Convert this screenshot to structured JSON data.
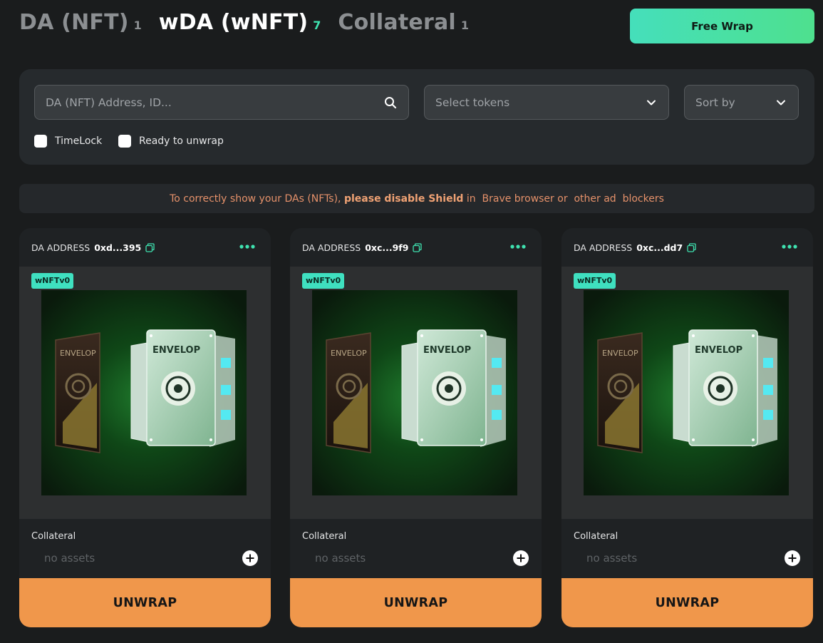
{
  "tabs": [
    {
      "label": "DA (NFT)",
      "count": "1",
      "active": false
    },
    {
      "label": "wDA (wNFT)",
      "count": "7",
      "active": true
    },
    {
      "label": "Collateral",
      "count": "1",
      "active": false
    }
  ],
  "free_wrap_label": "Free Wrap",
  "filters": {
    "search_placeholder": "DA (NFT) Address, ID...",
    "tokens_placeholder": "Select tokens",
    "sort_placeholder": "Sort by",
    "timelock_label": "TimeLock",
    "ready_label": "Ready to unwrap"
  },
  "notice": {
    "before": "To correctly show your DAs (NFTs), ",
    "bold": "please disable Shield",
    "after": " in  Brave browser or  other ad  blockers"
  },
  "cards": [
    {
      "address_label": "DA ADDRESS",
      "address": "0xd...395",
      "badge": "wNFTv0",
      "image_brand": "ENVELOP",
      "collateral_label": "Collateral",
      "collateral_value": "no assets",
      "unwrap_label": "UNWRAP"
    },
    {
      "address_label": "DA ADDRESS",
      "address": "0xc...9f9",
      "badge": "wNFTv0",
      "image_brand": "ENVELOP",
      "collateral_label": "Collateral",
      "collateral_value": "no assets",
      "unwrap_label": "UNWRAP"
    },
    {
      "address_label": "DA ADDRESS",
      "address": "0xc...dd7",
      "badge": "wNFTv0",
      "image_brand": "ENVELOP",
      "collateral_label": "Collateral",
      "collateral_value": "no assets",
      "unwrap_label": "UNWRAP"
    }
  ],
  "colors": {
    "background": "#1a1c1d",
    "accent_green": "#3fe3b0",
    "unwrap_orange": "#f0974b",
    "notice_text": "#e5916a"
  },
  "icons": {
    "search": "search-icon",
    "dropdown": "chevron-down-icon",
    "copy": "copy-icon",
    "more": "more-dots-icon",
    "add": "plus-circle-icon"
  }
}
